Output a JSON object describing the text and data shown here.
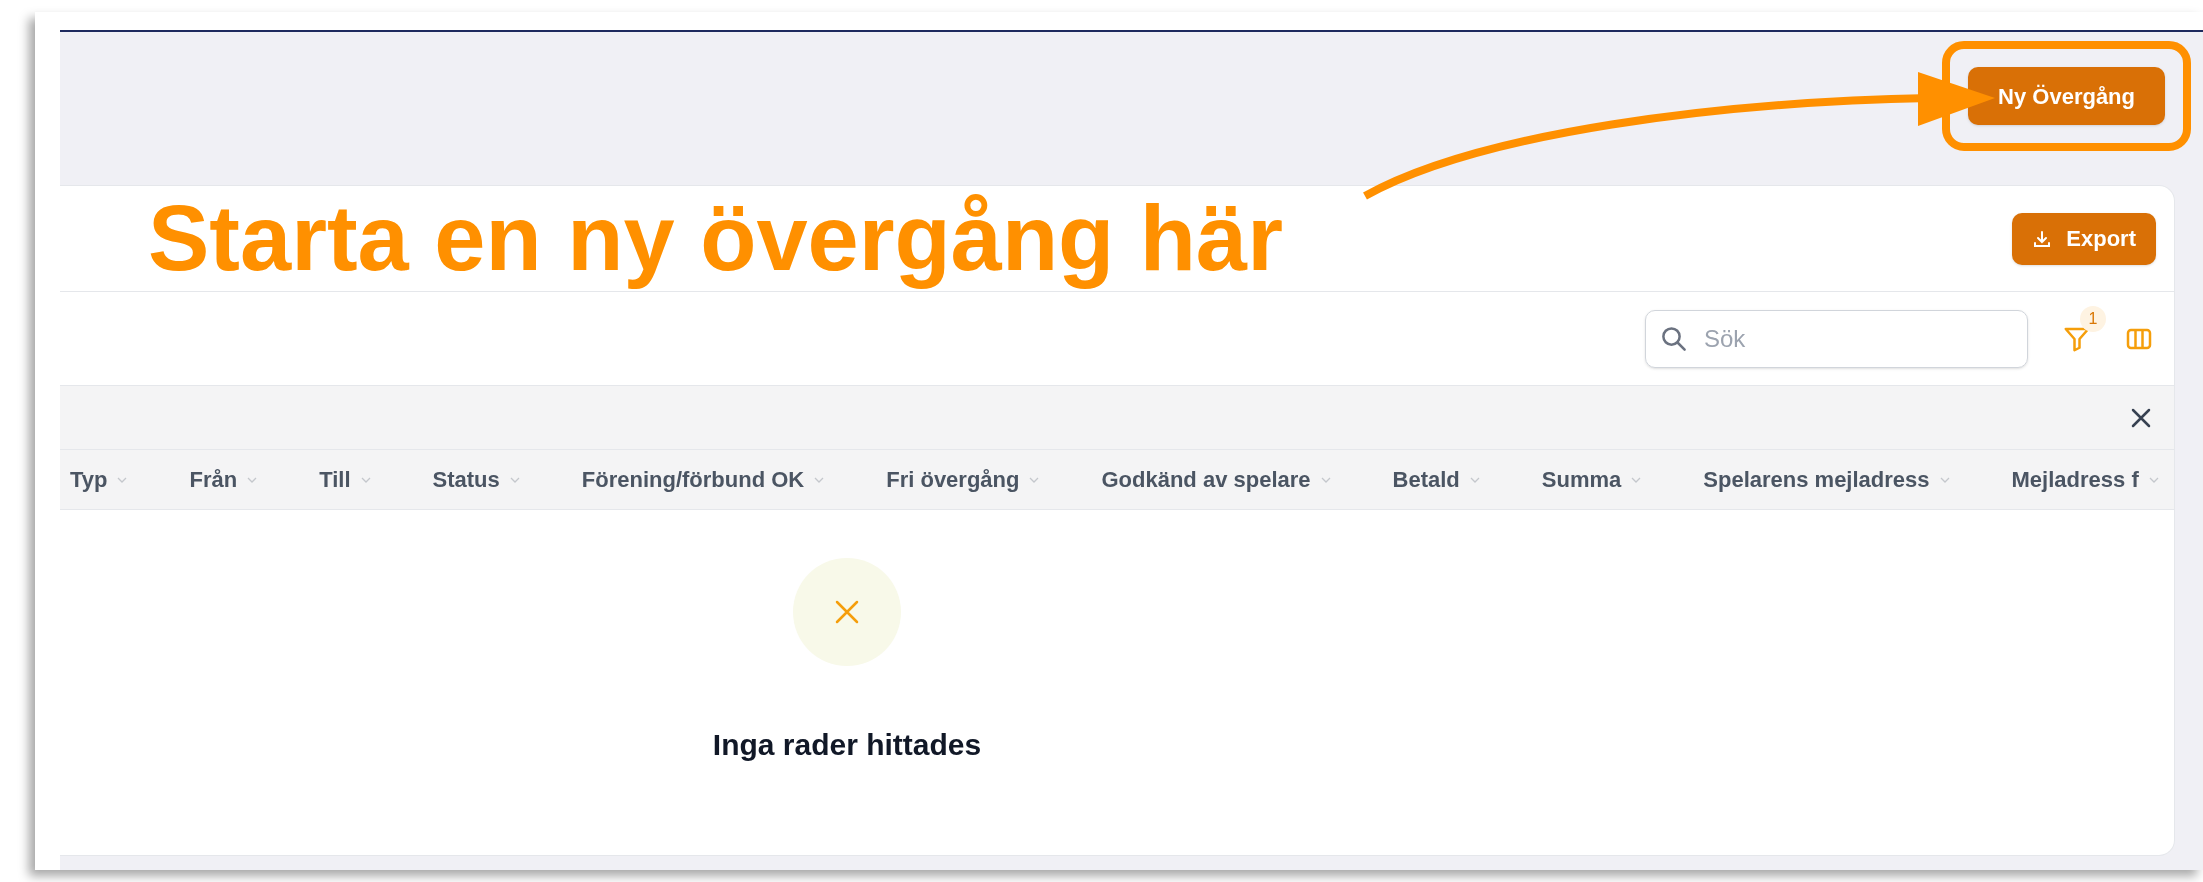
{
  "header": {
    "new_button": "Ny Övergång",
    "highlighted": true
  },
  "annotation": {
    "text": "Starta en ny övergång här"
  },
  "card": {
    "export_button": "Export",
    "search": {
      "placeholder": "Sök"
    },
    "filter_count": "1",
    "columns": [
      "Typ",
      "Från",
      "Till",
      "Status",
      "Förening/förbund OK",
      "Fri övergång",
      "Godkänd av spelare",
      "Betald",
      "Summa",
      "Spelarens mejladress",
      "Mejladress f"
    ],
    "empty_message": "Inga rader hittades"
  }
}
